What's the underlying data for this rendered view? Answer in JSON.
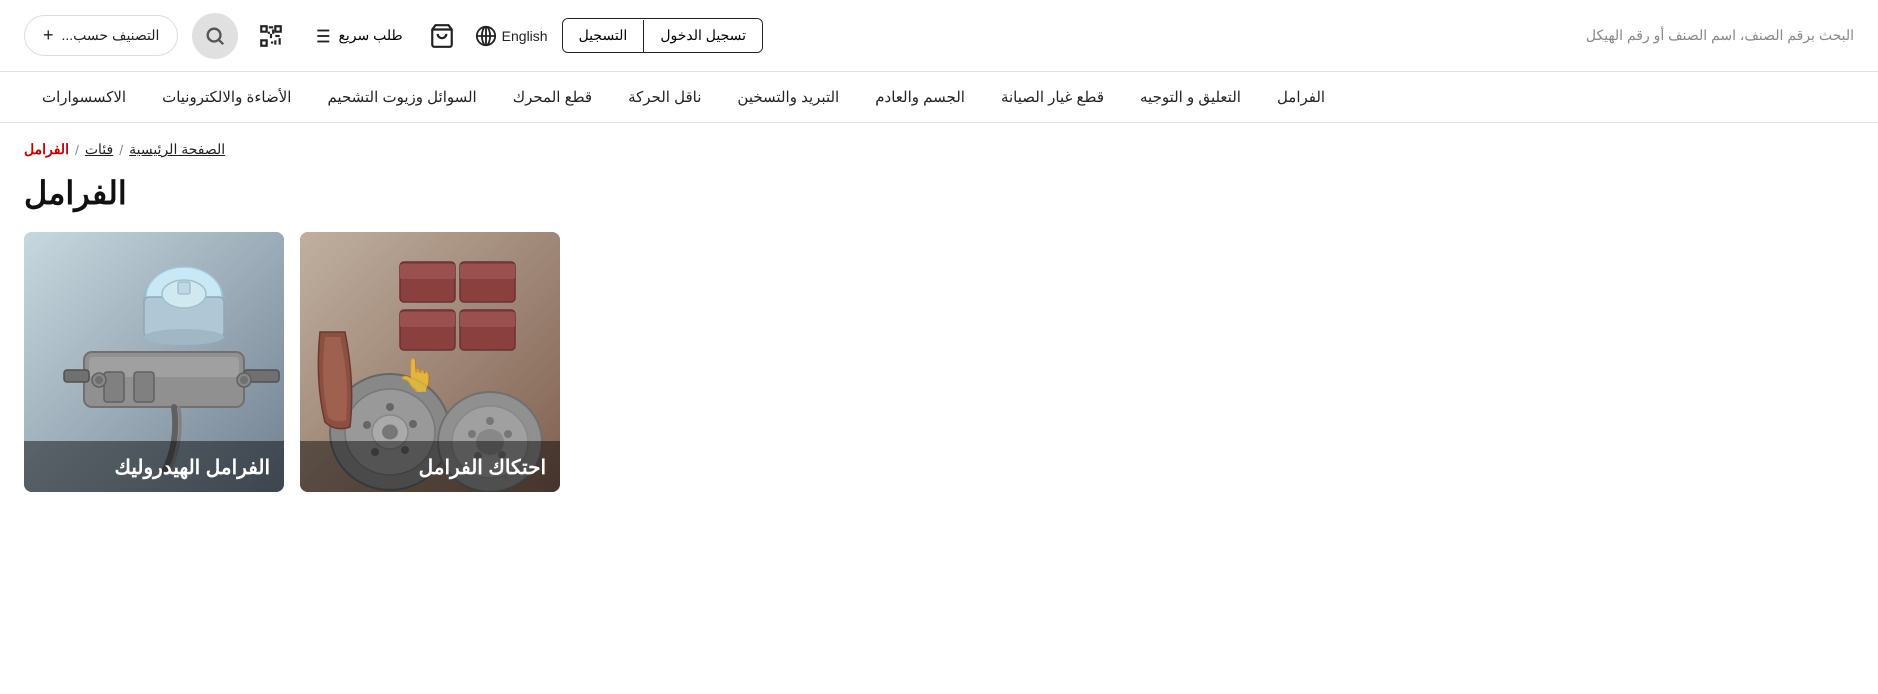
{
  "header": {
    "search_placeholder": "البحث برقم الصنف، اسم الصنف أو رقم الهيكل",
    "login_label": "تسجيل الدخول",
    "register_label": "التسجيل",
    "language_label": "English",
    "classify_label": "التصنيف حسب...",
    "classify_plus": "+",
    "quick_order_label": "طلب سريع"
  },
  "nav": {
    "items": [
      {
        "label": "الفرامل"
      },
      {
        "label": "التعليق و التوجيه"
      },
      {
        "label": "قطع غيار الصيانة"
      },
      {
        "label": "الجسم والعادم"
      },
      {
        "label": "التبريد والتسخين"
      },
      {
        "label": "ناقل الحركة"
      },
      {
        "label": "قطع المحرك"
      },
      {
        "label": "السوائل وزيوت التشحيم"
      },
      {
        "label": "الأضاءة والالكترونيات"
      },
      {
        "label": "الاكسسوارات"
      }
    ]
  },
  "breadcrumb": {
    "home_label": "الصفحة الرئيسية",
    "categories_label": "فئات",
    "current_label": "الفرامل",
    "sep": "/"
  },
  "page_title": "الفرامل",
  "cards": [
    {
      "id": "friction",
      "label": "احتكاك الفرامل",
      "bg_color1": "#a89888",
      "bg_color2": "#786858"
    },
    {
      "id": "hydraulic",
      "label": "الفرامل الهيدروليك",
      "bg_color1": "#b0c0cc",
      "bg_color2": "#7090a0"
    }
  ],
  "icons": {
    "search": "🔍",
    "cart": "🛒",
    "qr": "⬛",
    "list": "≡",
    "globe": "🌐",
    "plus": "+"
  }
}
